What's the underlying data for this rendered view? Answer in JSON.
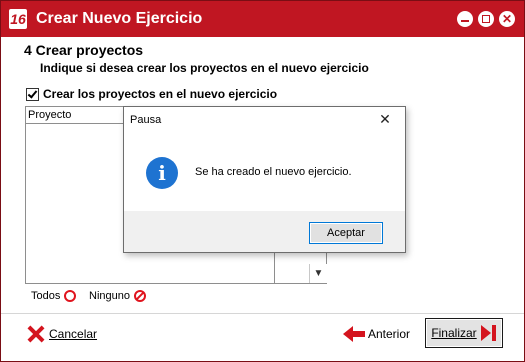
{
  "window": {
    "title": "Crear Nuevo Ejercicio",
    "app_icon": "16",
    "brand_color": "#c01622"
  },
  "step": {
    "title": "4  Crear proyectos",
    "subtitle": "Indique si desea crear los proyectos en el nuevo ejercicio"
  },
  "checkbox": {
    "label": "Crear los proyectos en el nuevo ejercicio",
    "checked": true
  },
  "table": {
    "columns": [
      "Proyecto"
    ]
  },
  "selection": {
    "todos_label": "Todos",
    "ninguno_label": "Ninguno"
  },
  "footer": {
    "cancel_label": "Cancelar",
    "back_label": "Anterior",
    "finish_label": "Finalizar"
  },
  "dialog": {
    "title": "Pausa",
    "message": "Se ha creado el nuevo ejercicio.",
    "ok_label": "Aceptar",
    "icon": "info-icon"
  }
}
